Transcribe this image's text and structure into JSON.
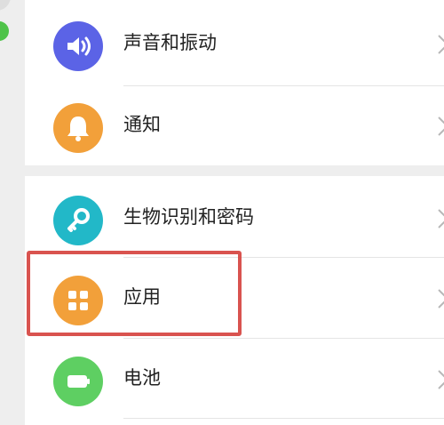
{
  "settings": {
    "items": [
      {
        "label": "声音和振动",
        "icon": "speaker-icon",
        "color": "#5b63e6"
      },
      {
        "label": "通知",
        "icon": "bell-icon",
        "color": "#f2a03a"
      },
      {
        "label": "生物识别和密码",
        "icon": "key-icon",
        "color": "#22b8c8"
      },
      {
        "label": "应用",
        "icon": "apps-grid-icon",
        "color": "#f2a03a"
      },
      {
        "label": "电池",
        "icon": "battery-icon",
        "color": "#5ecf62"
      }
    ]
  },
  "annotation": {
    "color": "#d9534f"
  }
}
